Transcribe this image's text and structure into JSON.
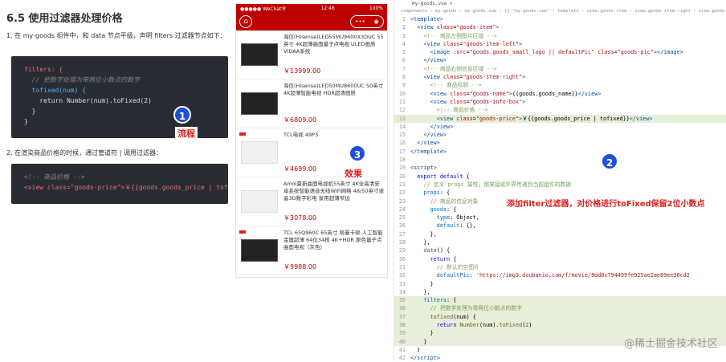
{
  "doc": {
    "title": "6.5 使用过滤器处理价格",
    "step1": "1. 在 my-goods 组件中，和 data 节点平级，声明 filters 过滤器节点如下：",
    "step2": "2. 在渲染商品价格的时候，通过管道符 | 调用过滤器：",
    "code1": [
      "filters: {",
      "  // 把数字处理为带两位小数点的数字",
      "  tofixed(num) {",
      "    return Number(num).toFixed(2)",
      "  }",
      "}"
    ],
    "code2": [
      "<!-- 商品价格 -->",
      "<view class=\"goods-price\">￥{{goods.goods_price | tofixed}}</view>"
    ]
  },
  "badges": {
    "one": "1",
    "two": "2",
    "three": "3"
  },
  "labels": {
    "flow": "流程",
    "effect": "效果"
  },
  "note": "添加filter过滤器，对价格进行toFixed保留2位小数点",
  "watermark": "@稀土掘金技术社区",
  "phone": {
    "carrier": "●●●●● WeChat令",
    "time": "12:46",
    "battery": "100%",
    "goods": [
      {
        "name": "海信(Hisense)LED55MU9600X3DUC 55英寸 4K超薄曲面量子点电视 ULED画质 VIDAA系统",
        "price": "￥13999.00",
        "style": "dark"
      },
      {
        "name": "海信(Hisense)LED50MU8600UC 50英寸 4K超薄智能电视 HDR超清画质",
        "price": "￥6809.00",
        "style": "dark"
      },
      {
        "name": "TCL电视 49P3",
        "price": "￥4699.00",
        "style": "light"
      },
      {
        "name": "Amoi夏新曲面电视机55英寸 4K全高清安卓系统智能语音无线WiFi网络 48/50英寸液晶3D数字彩电 家用超薄窄边",
        "price": "￥3078.00",
        "style": "light"
      },
      {
        "name": "TCL 65Q960C 65英寸 哈曼卡顿 人工智能 金属超薄 64位34核 4K+HDR 原色量子点 曲面电视（灰色）",
        "price": "￥9988.00",
        "style": "dark"
      }
    ]
  },
  "editor": {
    "tab": "my-goods.vue ×",
    "breadcrumb": "components › my-goods › my-goods.vue › {} \"my-goods.vue\" › template › view.goods-item › view.goods-item-right › view.goods-info-box"
  }
}
